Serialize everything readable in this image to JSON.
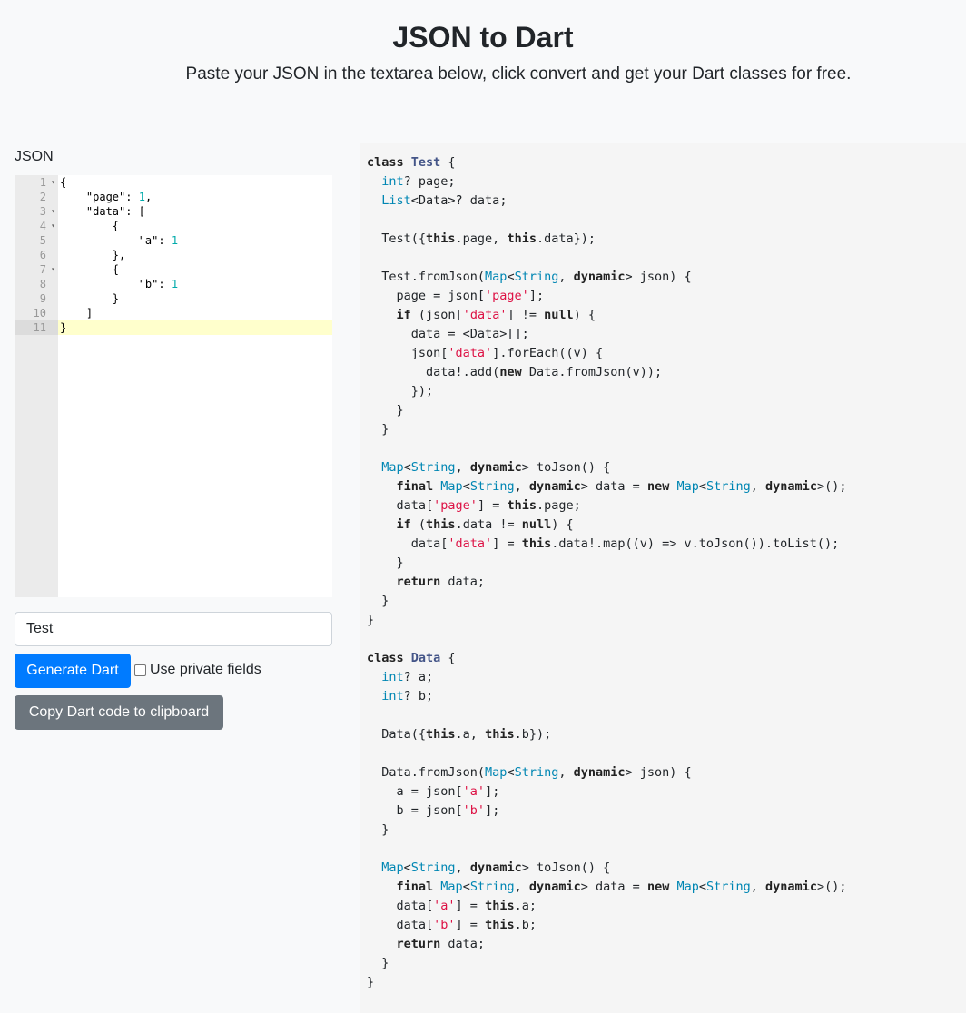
{
  "header": {
    "title": "JSON to Dart",
    "subtitle": "Paste your JSON in the textarea below, click convert and get your Dart classes for free."
  },
  "json_panel": {
    "label": "JSON",
    "lines": [
      {
        "n": "1",
        "fold": true
      },
      {
        "n": "2",
        "fold": false
      },
      {
        "n": "3",
        "fold": true
      },
      {
        "n": "4",
        "fold": true
      },
      {
        "n": "5",
        "fold": false
      },
      {
        "n": "6",
        "fold": false
      },
      {
        "n": "7",
        "fold": true
      },
      {
        "n": "8",
        "fold": false
      },
      {
        "n": "9",
        "fold": false
      },
      {
        "n": "10",
        "fold": false
      },
      {
        "n": "11",
        "fold": false
      }
    ],
    "code": {
      "l1": "{",
      "l2a": "    \"page\": ",
      "l2b": "1",
      "l2c": ",",
      "l3": "    \"data\": [",
      "l4": "        {",
      "l5a": "            \"a\": ",
      "l5b": "1",
      "l6": "        },",
      "l7": "        {",
      "l8a": "            \"b\": ",
      "l8b": "1",
      "l9": "        }",
      "l10": "    ]",
      "l11": "}"
    }
  },
  "class_name_input": {
    "value": "Test"
  },
  "buttons": {
    "generate": "Generate Dart",
    "copy": "Copy Dart code to clipboard"
  },
  "options": {
    "private_fields_label": "Use private fields",
    "private_fields_checked": false
  },
  "dart_output": {
    "t": {
      "class": "class",
      "int": "int",
      "list": "List",
      "map": "Map",
      "string": "String",
      "dynamic": "dynamic",
      "this": "this",
      "if": "if",
      "null": "null",
      "new": "new",
      "final": "final",
      "return": "return",
      "Test": "Test",
      "Data": "Data",
      "s_page": "'page'",
      "s_data": "'data'",
      "s_a": "'a'",
      "s_b": "'b'"
    }
  }
}
